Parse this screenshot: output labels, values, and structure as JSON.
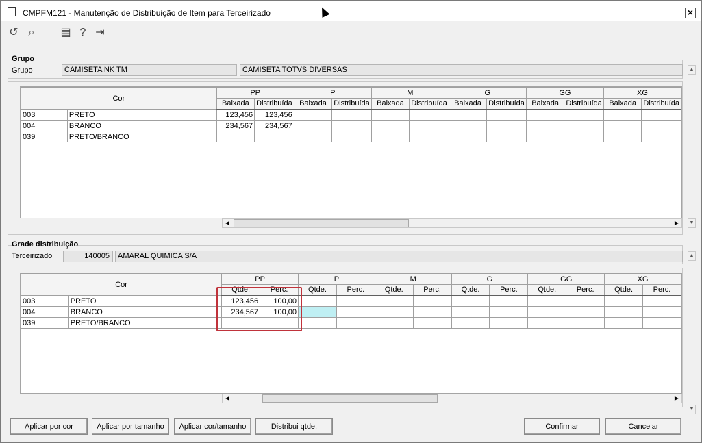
{
  "window": {
    "title": "CMPFM121 - Manutenção de Distribuição de Item para Terceirizado"
  },
  "toolbar": {
    "icons": [
      "undo-icon",
      "search-icon",
      "calendar-icon",
      "help-icon",
      "exit-icon"
    ]
  },
  "grupo": {
    "title": "Grupo",
    "label": "Grupo",
    "code": "CAMISETA NK TM",
    "description": "CAMISETA TOTVS DIVERSAS"
  },
  "grid1": {
    "cor_header": "Cor",
    "sizes": [
      "PP",
      "P",
      "M",
      "G",
      "GG",
      "XG"
    ],
    "subheaders": [
      "Baixada",
      "Distribuída"
    ],
    "rows": [
      {
        "code": "003",
        "name": "PRETO",
        "pp_a": "123,456",
        "pp_b": "123,456"
      },
      {
        "code": "004",
        "name": "BRANCO",
        "pp_a": "234,567",
        "pp_b": "234,567"
      },
      {
        "code": "039",
        "name": "PRETO/BRANCO",
        "pp_a": "",
        "pp_b": ""
      }
    ]
  },
  "grade": {
    "title": "Grade distribuição",
    "label": "Terceirizado",
    "code": "140005",
    "name": "AMARAL QUIMICA S/A"
  },
  "grid2": {
    "cor_header": "Cor",
    "sizes": [
      "PP",
      "P",
      "M",
      "G",
      "GG",
      "XG"
    ],
    "subheaders": [
      "Qtde.",
      "Perc."
    ],
    "rows": [
      {
        "code": "003",
        "name": "PRETO",
        "pp_a": "123,456",
        "pp_b": "100,00"
      },
      {
        "code": "004",
        "name": "BRANCO",
        "pp_a": "234,567",
        "pp_b": "100,00"
      },
      {
        "code": "039",
        "name": "PRETO/BRANCO",
        "pp_a": "",
        "pp_b": ""
      }
    ]
  },
  "buttons": {
    "aplicar_cor": "Aplicar por cor",
    "aplicar_tamanho": "Aplicar por tamanho",
    "aplicar_cor_tamanho": "Aplicar cor/tamanho",
    "distribui": "Distribui qtde.",
    "confirmar": "Confirmar",
    "cancelar": "Cancelar"
  },
  "colors": {
    "highlight": "#c0333b",
    "selected_cell": "#bfeff3"
  }
}
